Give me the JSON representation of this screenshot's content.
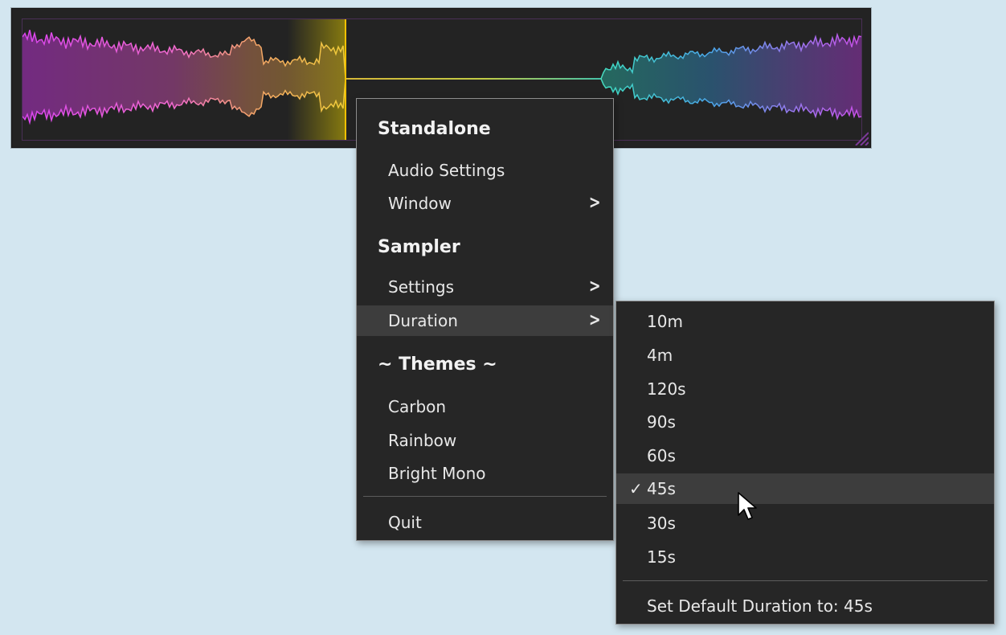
{
  "waveform": {
    "colors": [
      "#d945ee",
      "#f26ad0",
      "#f5a26c",
      "#f0cb3a",
      "#dcdc30",
      "#d8e34a",
      "#3fd8c4",
      "#4aa6e8",
      "#9877ee",
      "#c84fe6"
    ],
    "playhead_color": "#f0c000",
    "background": "#232323"
  },
  "main_menu": {
    "sections": [
      {
        "header": "Standalone"
      },
      {
        "label": "Audio Settings",
        "has_submenu": false
      },
      {
        "label": "Window",
        "has_submenu": true
      },
      {
        "header": "Sampler"
      },
      {
        "label": "Settings",
        "has_submenu": true
      },
      {
        "label": "Duration",
        "has_submenu": true,
        "active": true
      },
      {
        "header": "~ Themes ~"
      },
      {
        "label": "Carbon"
      },
      {
        "label": "Rainbow"
      },
      {
        "label": "Bright Mono"
      },
      {
        "label": "Quit"
      }
    ],
    "standalone_header": "Standalone",
    "audio_settings": "Audio Settings",
    "window": "Window",
    "sampler_header": "Sampler",
    "settings": "Settings",
    "duration": "Duration",
    "themes_header": "~ Themes ~",
    "carbon": "Carbon",
    "rainbow": "Rainbow",
    "bright_mono": "Bright Mono",
    "quit": "Quit",
    "submenu_arrow": ">"
  },
  "duration_menu": {
    "options": [
      "10m",
      "4m",
      "120s",
      "90s",
      "60s",
      "45s",
      "30s",
      "15s"
    ],
    "selected": "45s",
    "check_glyph": "✓",
    "set_default": "Set Default Duration to: 45s"
  }
}
